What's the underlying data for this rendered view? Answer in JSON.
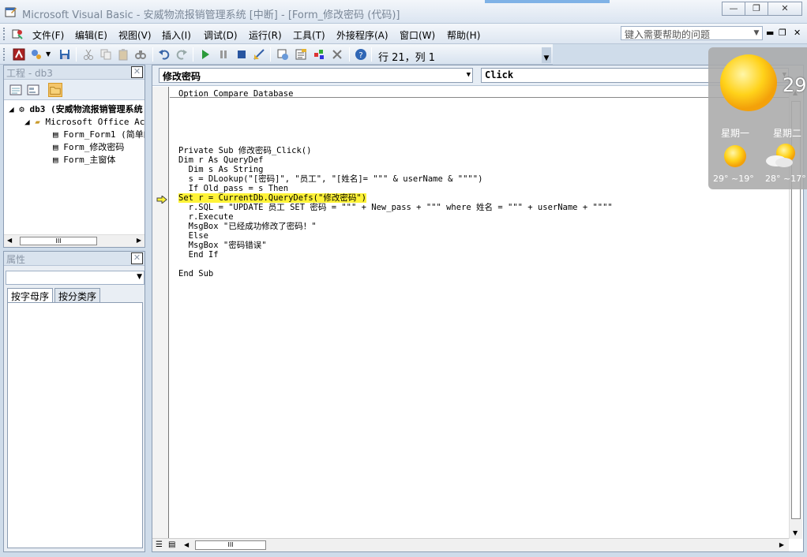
{
  "window": {
    "title": "Microsoft Visual Basic - 安威物流报销管理系统 [中断] - [Form_修改密码 (代码)]",
    "minimize_label": "—",
    "restore_label": "❐",
    "close_label": "✕"
  },
  "menu": {
    "items": [
      "文件(F)",
      "编辑(E)",
      "视图(V)",
      "插入(I)",
      "调试(D)",
      "运行(R)",
      "工具(T)",
      "外接程序(A)",
      "窗口(W)",
      "帮助(H)"
    ],
    "help_placeholder": "键入需要帮助的问题",
    "mdi_min": "▬",
    "mdi_restore": "❐",
    "mdi_close": "✕"
  },
  "toolbar": {
    "cursor_position": "行 21，列 1"
  },
  "project_pane": {
    "title": "工程 - db3",
    "tree": [
      {
        "label": "db3 (安威物流报销管理系统",
        "level": 0,
        "bold": true
      },
      {
        "label": "Microsoft Office Ac",
        "level": 1,
        "bold": false
      },
      {
        "label": "Form_Form1 (简单的",
        "level": 2,
        "bold": false
      },
      {
        "label": "Form_修改密码",
        "level": 2,
        "bold": false
      },
      {
        "label": "Form_主窗体",
        "level": 2,
        "bold": false
      }
    ],
    "scroll_grip": "III"
  },
  "props_pane": {
    "title": "属性",
    "tab_alpha": "按字母序",
    "tab_category": "按分类序"
  },
  "code_window": {
    "object_combo": "修改密码",
    "proc_combo": "Click",
    "lines": [
      "Option Compare Database",
      "",
      "",
      "",
      "",
      "",
      "Private Sub 修改密码_Click()",
      "Dim r As QueryDef",
      "  Dim s As String",
      "  s = DLookup(\"[密码]\", \"员工\", \"[姓名]= \"\"\" & userName & \"\"\"\")",
      "  If Old_pass = s Then",
      "Set r = CurrentDb.QueryDefs(\"修改密码\")",
      "  r.SQL = \"UPDATE 员工 SET 密码 = \"\"\" + New_pass + \"\"\" where 姓名 = \"\"\" + userName + \"\"\"\"",
      "  r.Execute",
      "  MsgBox \"已经成功修改了密码！\"",
      "  Else",
      "  MsgBox \"密码错误\"",
      "  End If",
      "",
      "End Sub"
    ],
    "highlight_line": 11,
    "scroll_grip": "III"
  },
  "weather": {
    "current_temp": "29",
    "days": [
      {
        "name": "星期一",
        "range": "29° ~19°"
      },
      {
        "name": "星期二",
        "range": "28° ~17°"
      }
    ]
  },
  "colors": {
    "highlight": "#fff338",
    "titlebar_text": "#7a8797"
  }
}
